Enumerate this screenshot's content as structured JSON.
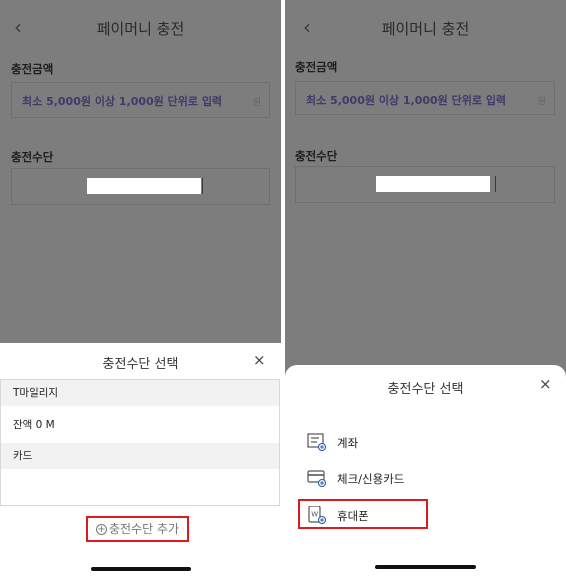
{
  "left": {
    "header": {
      "back_icon": "‹",
      "title": "페이머니 충전"
    },
    "amount": {
      "label": "충전금액",
      "placeholder": "최소 5,000원 이상 1,000원 단위로 입력",
      "unit": "원"
    },
    "method": {
      "label": "충전수단"
    },
    "sheet": {
      "title": "충전수단 선택",
      "close_icon": "×",
      "items": [
        {
          "label": "T마일리지"
        },
        {
          "label": "잔액 0 M"
        },
        {
          "label": "카드"
        }
      ],
      "add_button": {
        "icon": "+",
        "label": "충전수단 추가"
      }
    }
  },
  "right": {
    "header": {
      "back_icon": "‹",
      "title": "페이머니 충전"
    },
    "amount": {
      "label": "충전금액",
      "placeholder": "최소 5,000원 이상 1,000원 단위로 입력",
      "unit": "원"
    },
    "method": {
      "label": "충전수단"
    },
    "sheet": {
      "title": "충전수단 선택",
      "close_icon": "×",
      "options": [
        {
          "label": "계좌",
          "icon": "account-icon"
        },
        {
          "label": "체크/신용카드",
          "icon": "card-icon"
        },
        {
          "label": "휴대폰",
          "icon": "phone-icon"
        }
      ]
    }
  },
  "colors": {
    "highlight": "#e0191c",
    "dim": "#7d7d7d",
    "placeholder": "#3f3a6a"
  }
}
